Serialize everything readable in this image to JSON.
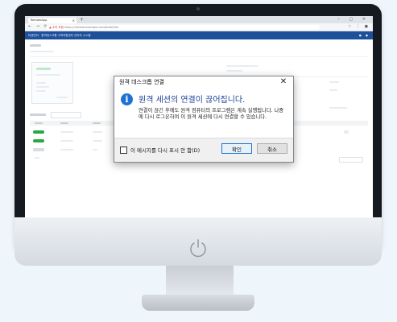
{
  "browser": {
    "tab_title": "RemoteApp",
    "tab_close": "×",
    "new_tab": "+",
    "window_controls": "‒ ▢ ✕",
    "nav_icons": "← → ⟳",
    "url_warning": "▲ 주의 요함",
    "url": "https://remote.example.com/ticket/list",
    "addr_icons": "☆ ⋮ ●"
  },
  "app": {
    "header_title": "티켓관리 · 원격데스크톱 고객지원센터 관리자 시스템",
    "header_icons": "● ●"
  },
  "dialog": {
    "title": "원격 데스크톱 연결",
    "close": "✕",
    "icon": "i",
    "heading": "원격 세션의 연결이 끊어집니다.",
    "message": "연결이 끊긴 후에도 원격 컴퓨터의 프로그램은 계속 실행됩니다. 나중에 다시 로그온하여 이 원격 세션에 다시 연결할 수 있습니다.",
    "checkbox_label": "이 메시지를 다시 표시 안 함(D)",
    "ok_label": "확인",
    "cancel_label": "취소"
  },
  "colors": {
    "app_header": "#1d4f9a",
    "info_icon": "#1e73d2",
    "heading": "#1c3f9a",
    "status_green": "#28a745"
  }
}
